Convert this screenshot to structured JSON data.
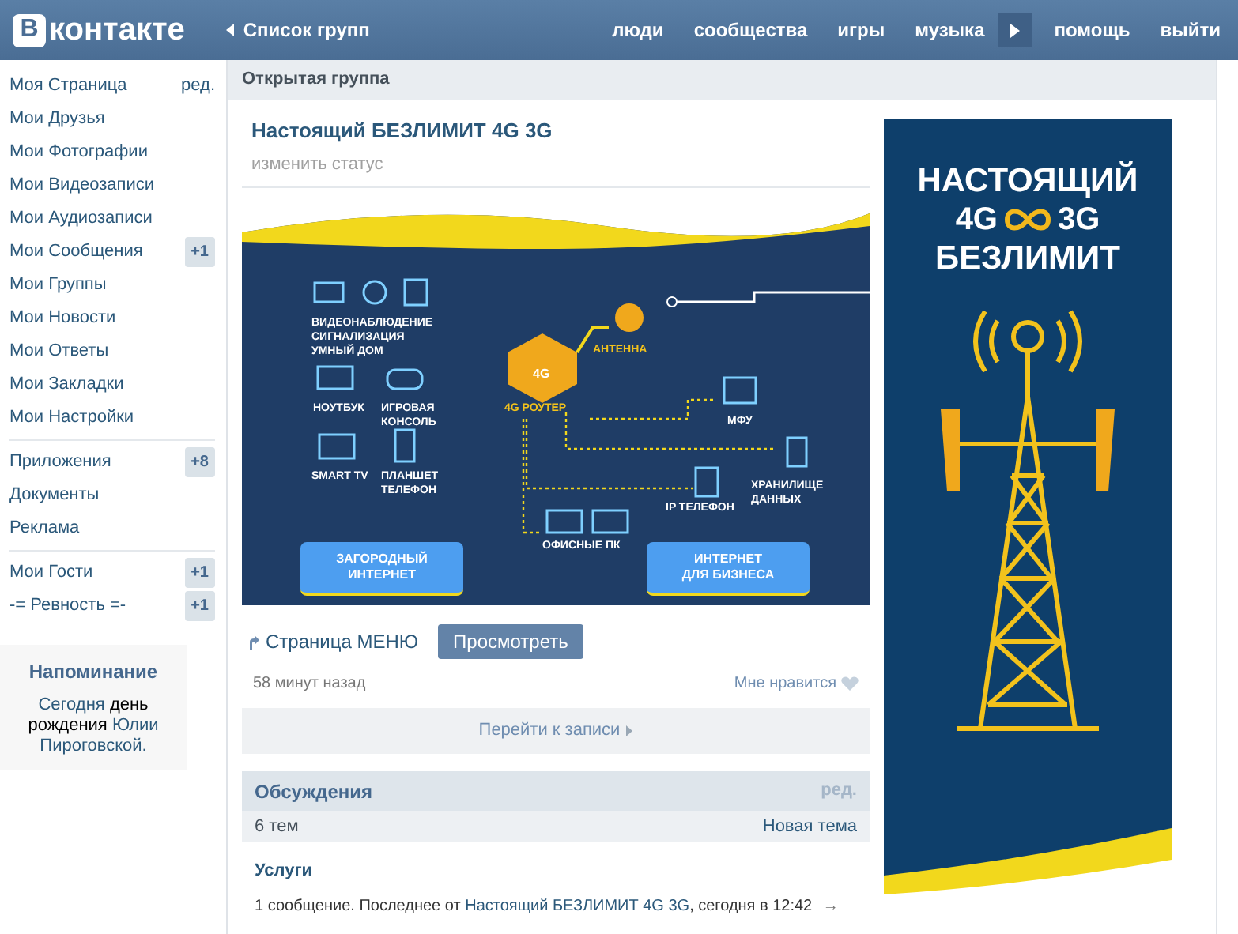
{
  "header": {
    "logo": {
      "mark": "В",
      "text": "контакте"
    },
    "back_link": "Список групп",
    "nav": [
      "люди",
      "сообщества",
      "игры",
      "музыка"
    ],
    "nav_end": [
      "помощь",
      "выйти"
    ]
  },
  "sidebar": {
    "groups": [
      [
        {
          "label": "Моя Страница",
          "action": "ред."
        },
        {
          "label": "Мои Друзья"
        },
        {
          "label": "Мои Фотографии"
        },
        {
          "label": "Мои Видеозаписи"
        },
        {
          "label": "Мои Аудиозаписи"
        },
        {
          "label": "Мои Сообщения",
          "badge": "+1"
        },
        {
          "label": "Мои Группы"
        },
        {
          "label": "Мои Новости"
        },
        {
          "label": "Мои Ответы"
        },
        {
          "label": "Мои Закладки"
        },
        {
          "label": "Мои Настройки"
        }
      ],
      [
        {
          "label": "Приложения",
          "badge": "+8"
        },
        {
          "label": "Документы"
        },
        {
          "label": "Реклама"
        }
      ],
      [
        {
          "label": "Мои Гости",
          "badge": "+1"
        },
        {
          "label": "-= Ревность =-",
          "badge": "+1"
        }
      ]
    ],
    "reminder": {
      "title": "Напоминание",
      "prefix": "Сегодня",
      "event": "день",
      "middle": "рождения",
      "name": "Юлии Пироговской."
    }
  },
  "page_header": "Открытая группа",
  "group": {
    "name": "Настоящий БЕЗЛИМИТ 4G 3G",
    "status": "изменить статус"
  },
  "banner": {
    "labels": [
      "ВИДЕОНАБЛЮДЕНИЕ\nСИГНАЛИЗАЦИЯ\nУМНЫЙ ДОМ",
      "НОУТБУК",
      "ИГРОВАЯ\nКОНСОЛЬ",
      "SMART TV",
      "ПЛАНШЕТ\nТЕЛЕФОН",
      "АНТЕННА",
      "4G РОУТЕР",
      "МФУ",
      "ХРАНИЛИЩЕ\nДАННЫХ",
      "IP ТЕЛЕФОН",
      "ОФИСНЫЕ ПК"
    ],
    "chip": "4G",
    "buttons": [
      "ЗАГОРОДНЫЙ\nИНТЕРНЕТ",
      "ИНТЕРНЕТ\nДЛЯ БИЗНЕСА"
    ]
  },
  "post": {
    "link": "Страница МЕНЮ",
    "button": "Просмотреть",
    "time": "58 минут назад",
    "like": "Мне нравится",
    "goto": "Перейти к записи"
  },
  "discussions": {
    "title": "Обсуждения",
    "edit": "ред.",
    "count": "6 тем",
    "new_topic": "Новая тема",
    "topics": [
      {
        "title": "Услуги",
        "meta": "1 сообщение. Последнее от",
        "author": "Настоящий БЕЗЛИМИТ 4G 3G",
        "time": ", сегодня в 12:42",
        "arrow": "→"
      }
    ]
  },
  "side_banner": {
    "line1": "НАСТОЯЩИЙ",
    "left": "4G",
    "right": "3G",
    "line3": "БЕЗЛИМИТ"
  }
}
